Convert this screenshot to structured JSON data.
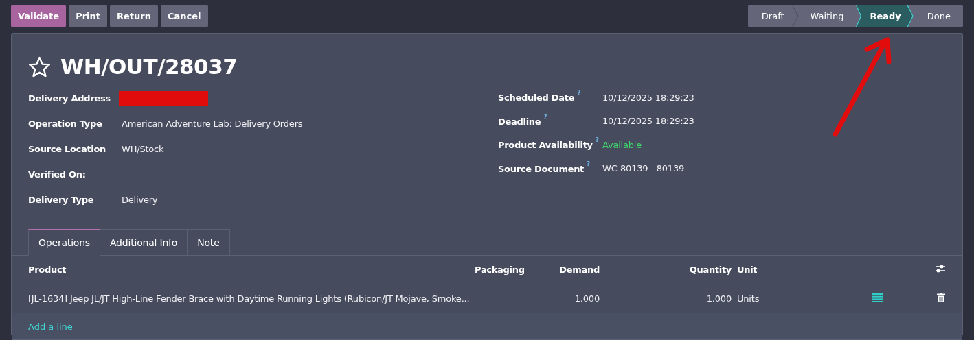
{
  "actions": [
    {
      "label": "Validate",
      "kind": "primary"
    },
    {
      "label": "Print",
      "kind": "secondary"
    },
    {
      "label": "Return",
      "kind": "secondary"
    },
    {
      "label": "Cancel",
      "kind": "secondary"
    }
  ],
  "stages": [
    {
      "label": "Draft",
      "selected": false
    },
    {
      "label": "Waiting",
      "selected": false
    },
    {
      "label": "Ready",
      "selected": true
    },
    {
      "label": "Done",
      "selected": false
    }
  ],
  "record": {
    "title": "WH/OUT/28037",
    "starred": false
  },
  "fields_left": [
    {
      "label": "Delivery Address",
      "redacted": true
    },
    {
      "label": "Operation Type",
      "value": "American Adventure Lab: Delivery Orders"
    },
    {
      "label": "Source Location",
      "value": "WH/Stock"
    },
    {
      "label": "Verified On:"
    },
    {
      "label": "Delivery Type",
      "value": "Delivery"
    }
  ],
  "fields_right": [
    {
      "label": "Scheduled Date",
      "help": "?",
      "value": "10/12/2025 18:29:23",
      "kind": "text"
    },
    {
      "label": "Deadline",
      "help": "?",
      "value": "10/12/2025 18:29:23",
      "kind": "text"
    },
    {
      "label": "Product Availability",
      "help": "?",
      "value": "Available",
      "kind": "status"
    },
    {
      "label": "Source Document",
      "help": "?",
      "value": "WC-80139 - 80139",
      "kind": "text"
    }
  ],
  "tabs": [
    {
      "label": "Operations",
      "selected": true
    },
    {
      "label": "Additional Info",
      "selected": false
    },
    {
      "label": "Note",
      "selected": false
    }
  ],
  "table": {
    "columns": [
      "Product",
      "Packaging",
      "Demand",
      "Quantity",
      "Unit"
    ],
    "rows": [
      {
        "product": "[JL-1634] Jeep JL/JT High-Line Fender Brace with Daytime Running Lights (Rubicon/JT Mojave, Smoke...",
        "demand": "1.000",
        "quantity": "1.000",
        "unit": "Units"
      }
    ],
    "add_line": "Add a line"
  }
}
